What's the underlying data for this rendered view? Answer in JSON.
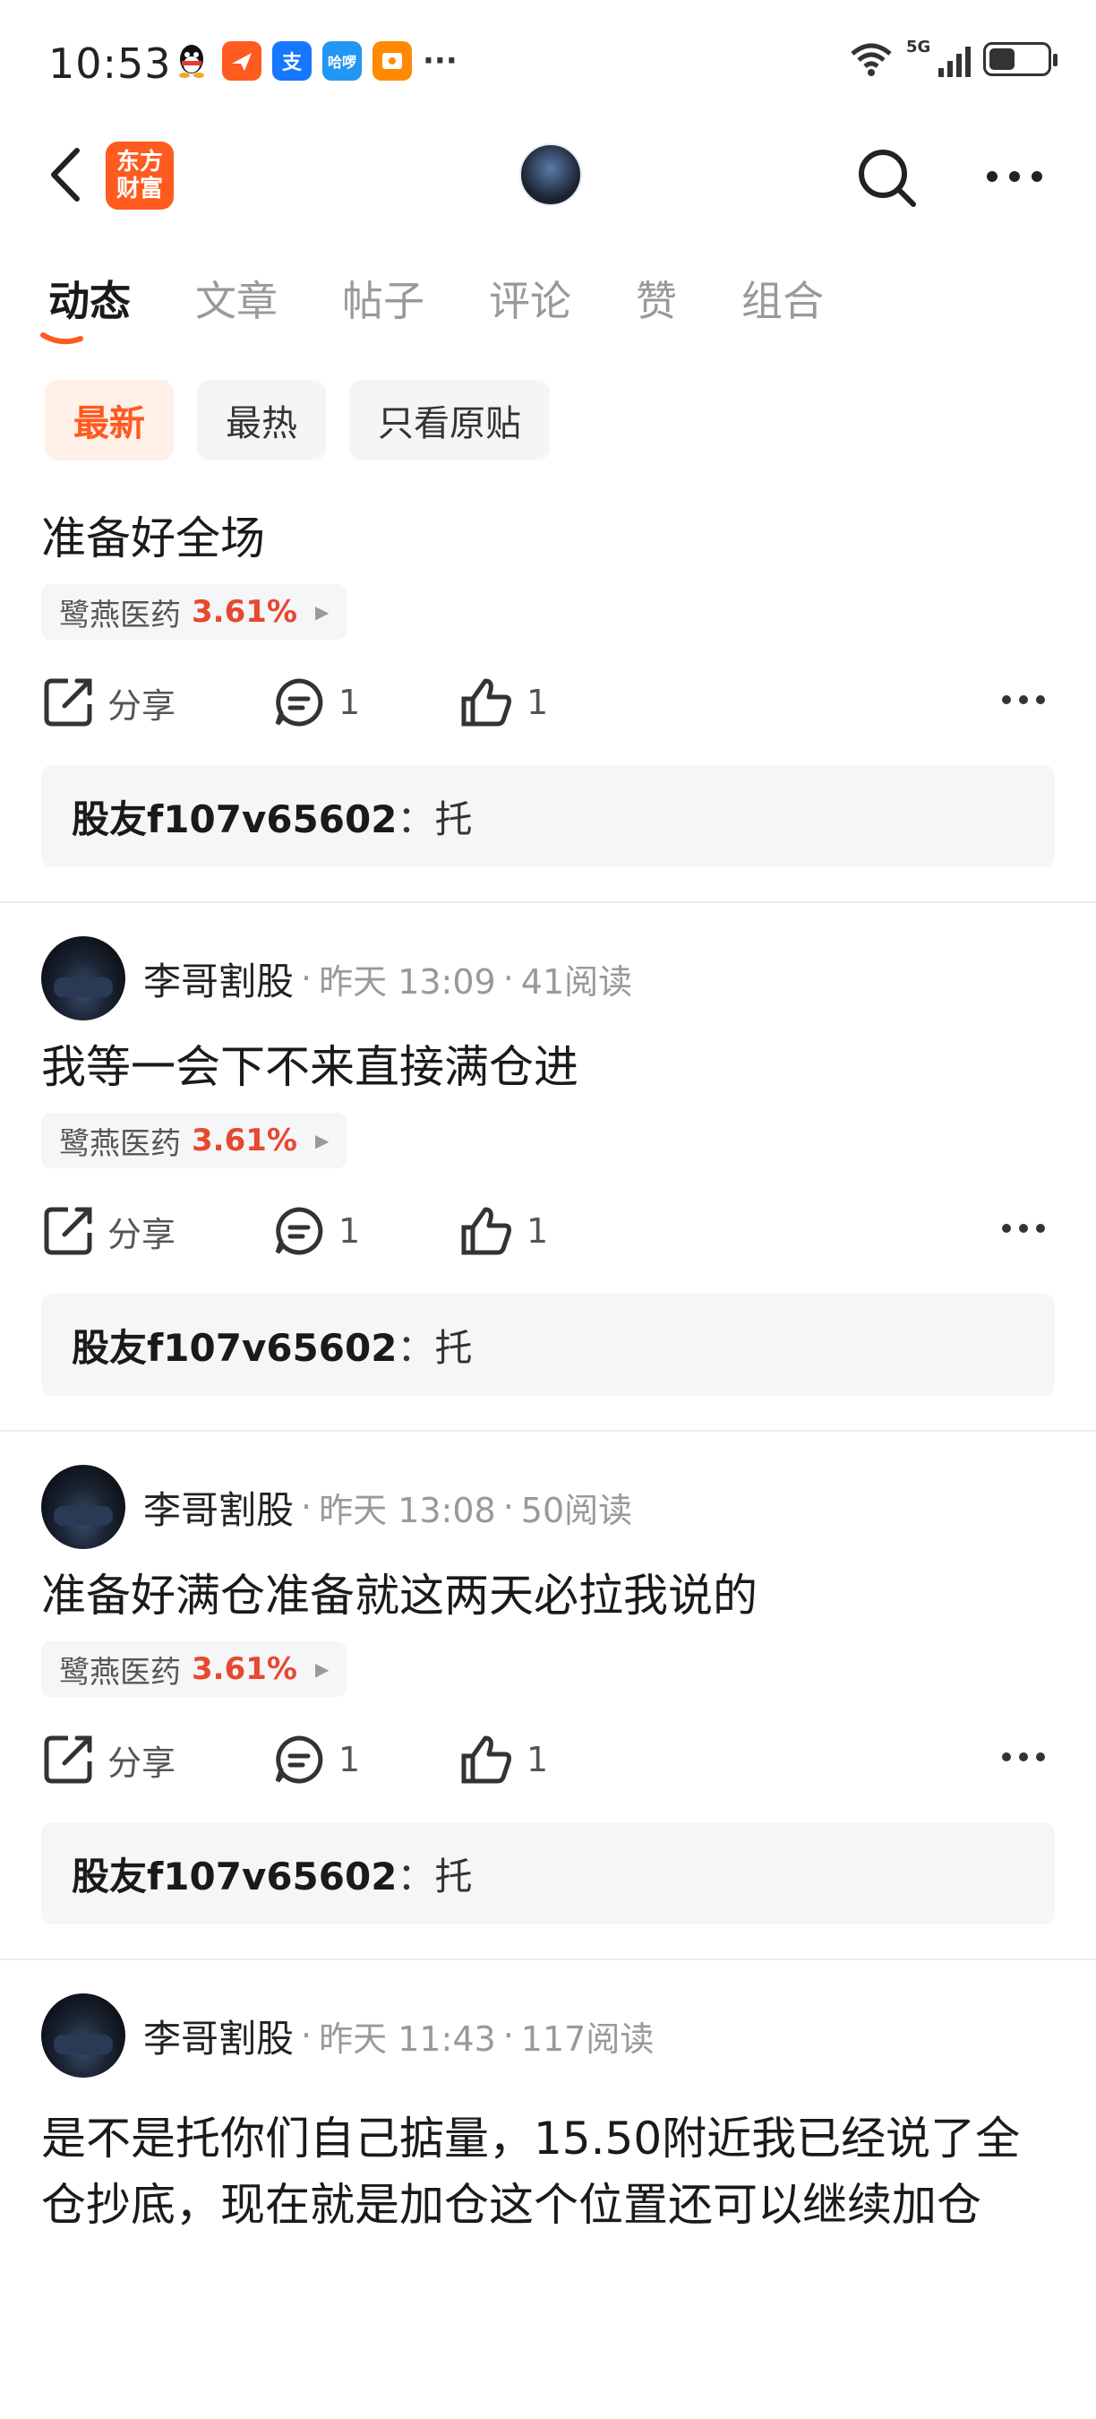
{
  "status_bar": {
    "time": "10:53",
    "notification_icons": [
      "qq-icon",
      "feishu-icon",
      "alipay-icon",
      "hello-icon",
      "wallet-icon"
    ],
    "more": "···",
    "network": "5G",
    "battery_level": 0.45
  },
  "nav": {
    "brand": "东方财富"
  },
  "tabs": [
    {
      "label": "动态",
      "active": true
    },
    {
      "label": "文章",
      "active": false
    },
    {
      "label": "帖子",
      "active": false
    },
    {
      "label": "评论",
      "active": false
    },
    {
      "label": "赞",
      "active": false
    },
    {
      "label": "组合",
      "active": false
    }
  ],
  "filters": [
    {
      "label": "最新",
      "active": true
    },
    {
      "label": "最热",
      "active": false
    },
    {
      "label": "只看原贴",
      "active": false
    }
  ],
  "colors": {
    "accent": "#ff5a1f",
    "up_red": "#e8482f"
  },
  "posts": [
    {
      "author": "",
      "time": "",
      "reads": "",
      "content": "准备好全场",
      "stock": {
        "name": "鹭燕医药",
        "change": "3.61%"
      },
      "share": "分享",
      "comments": "1",
      "likes": "1",
      "reply": {
        "user": "股友f107v65602",
        "text": "托"
      }
    },
    {
      "author": "李哥割股",
      "time": "昨天 13:09",
      "reads": "41阅读",
      "content": "我等一会下不来直接满仓进",
      "stock": {
        "name": "鹭燕医药",
        "change": "3.61%"
      },
      "share": "分享",
      "comments": "1",
      "likes": "1",
      "reply": {
        "user": "股友f107v65602",
        "text": "托"
      }
    },
    {
      "author": "李哥割股",
      "time": "昨天 13:08",
      "reads": "50阅读",
      "content": "准备好满仓准备就这两天必拉我说的",
      "stock": {
        "name": "鹭燕医药",
        "change": "3.61%"
      },
      "share": "分享",
      "comments": "1",
      "likes": "1",
      "reply": {
        "user": "股友f107v65602",
        "text": "托"
      }
    },
    {
      "author": "李哥割股",
      "time": "昨天 11:43",
      "reads": "117阅读",
      "content": "是不是托你们自己掂量，15.50附近我已经说了全仓抄底，现在就是加仓这个位置还可以继续加仓"
    }
  ]
}
